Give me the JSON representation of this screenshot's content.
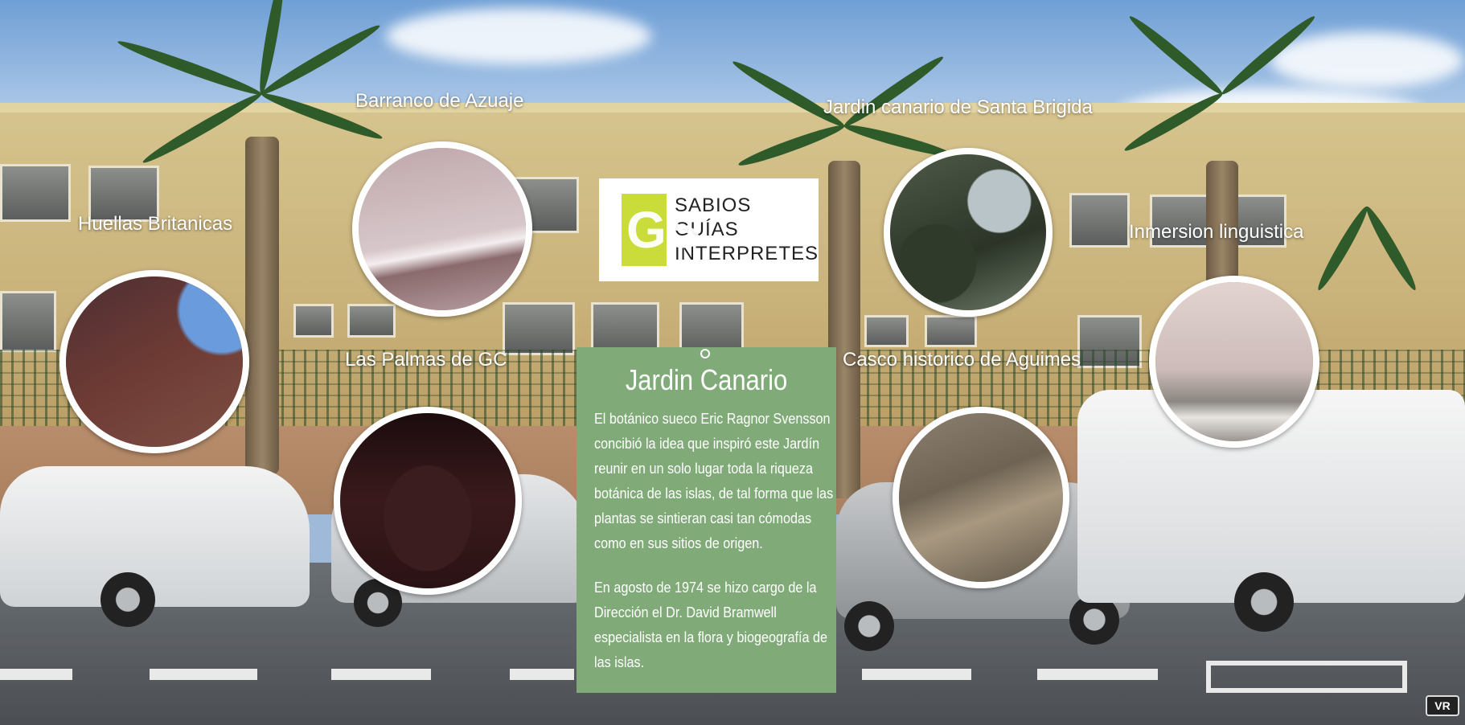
{
  "hotspots": [
    {
      "label": "Barranco de Azuaje",
      "thumb_colors": [
        "#c8b0b3",
        "#8b6a6d"
      ]
    },
    {
      "label": "Jardin canario de Santa Brigida",
      "thumb_colors": [
        "#40503a",
        "#b9c4c9"
      ]
    },
    {
      "label": "Huellas Britanicas",
      "thumb_colors": [
        "#6b3a33",
        "#5c8cd0"
      ]
    },
    {
      "label": "Inmersion linguistica",
      "thumb_colors": [
        "#d9c9c7",
        "#8f8783"
      ]
    },
    {
      "label": "Las Palmas de GC",
      "thumb_colors": [
        "#2a1416",
        "#6a3a3b"
      ]
    },
    {
      "label": "Casco historico de Aguimes",
      "thumb_colors": [
        "#7a6e5c",
        "#b6a68a"
      ]
    }
  ],
  "logo": {
    "mark": "GS",
    "lines": [
      "SABIOS",
      "GUÍAS",
      "INTERPRETES"
    ],
    "mark_color": "#c9dc3a"
  },
  "info_panel": {
    "title": "Jardin Canario",
    "paragraphs": [
      "El botánico sueco Eric Ragnor Svensson concibió la idea que inspiró este Jardín reunir en un solo lugar toda la riqueza botánica de las islas, de tal forma que las plantas se sintieran casi tan cómodas como en sus sitios de origen.",
      "En agosto de 1974 se hizo cargo de la Dirección el Dr. David Bramwell especialista en la flora y biogeografía de las islas."
    ],
    "background": "#80ab78"
  },
  "vr_button": {
    "label": "VR"
  }
}
